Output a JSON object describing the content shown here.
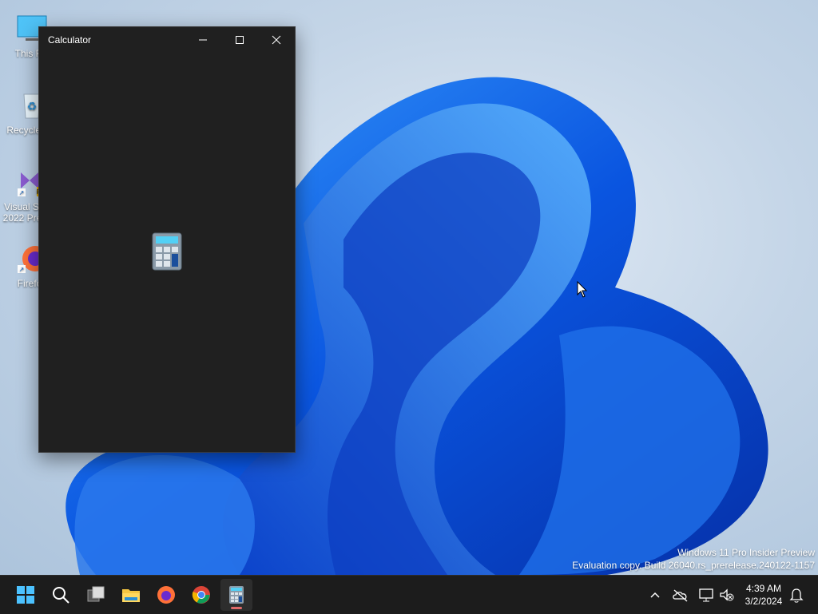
{
  "desktop": {
    "icons": [
      {
        "label": "This PC",
        "icon": "this-pc-icon"
      },
      {
        "label": "Recycle Bin",
        "icon": "recycle-bin-icon"
      },
      {
        "label": "Visual Studio 2022 Preview",
        "icon": "visual-studio-icon"
      },
      {
        "label": "Firefox",
        "icon": "firefox-icon"
      }
    ],
    "watermark_line1": "Windows 11 Pro Insider Preview",
    "watermark_line2": "Evaluation copy. Build 26040.rs_prerelease.240122-1157"
  },
  "calculator_window": {
    "title": "Calculator",
    "splash_icon": "calculator-icon"
  },
  "taskbar": {
    "items": [
      "start-icon",
      "search-icon",
      "task-view-icon",
      "file-explorer-icon",
      "firefox-icon",
      "chrome-icon",
      "calculator-icon"
    ],
    "tray": [
      "chevron-up-icon",
      "onedrive-icon",
      "network-icon",
      "volume-muted-icon",
      "notification-bell-icon"
    ],
    "clock_time": "4:39 AM",
    "clock_date": "3/2/2024"
  },
  "colors": {
    "accent": "#0067c0",
    "window_bg": "#202020",
    "taskbar_bg": "#1c1c1c"
  }
}
